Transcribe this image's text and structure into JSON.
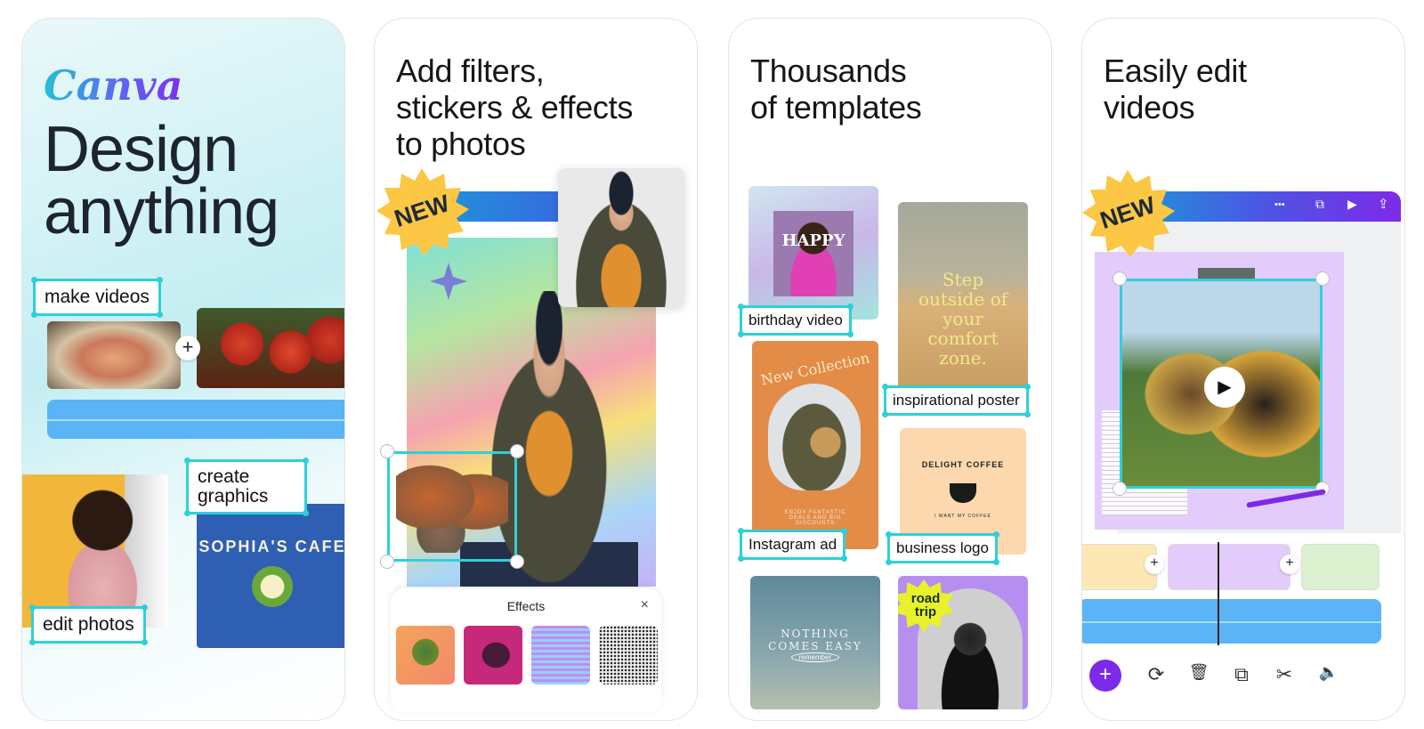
{
  "panels": [
    {
      "logo": "Canva",
      "headline_line1": "Design",
      "headline_line2": "anything",
      "tags": [
        "make videos",
        "create graphics",
        "edit photos"
      ],
      "graphic_text": "SOPHIA'S CAFE",
      "timeline_add": "+"
    },
    {
      "headline_line1": "Add filters,",
      "headline_line2": "stickers & effects",
      "headline_line3": "to photos",
      "badge": "NEW",
      "toolbar_more": "•••",
      "effects_panel": {
        "title": "Effects",
        "close_icon": "×",
        "thumbnails": [
          "effect-duotone-green",
          "effect-duotone-magenta",
          "effect-glitch",
          "effect-halftone"
        ]
      }
    },
    {
      "headline_line1": "Thousands",
      "headline_line2": "of templates",
      "templates": [
        {
          "label": "birthday video",
          "content": "HAPPY BIRTHDAY"
        },
        {
          "label": "inspirational poster",
          "content": "Step outside of your comfort zone."
        },
        {
          "label": "Instagram ad",
          "content": "New Collection",
          "subtext": "ENJOY FANTASTIC DEALS AND BIG DISCOUNTS"
        },
        {
          "label": "business logo",
          "content": "DELIGHT COFFEE",
          "subtext": "I WANT MY COFFEE"
        },
        {
          "label": "",
          "content": "NOTHING COMES EASY",
          "subtext": "remember"
        },
        {
          "label": "",
          "content": "road trip"
        }
      ]
    },
    {
      "headline_line1": "Easily edit",
      "headline_line2": "videos",
      "badge": "NEW",
      "toolbar": {
        "more": "•••",
        "pages": "⧉",
        "play": "▶",
        "share": "⇪"
      },
      "play_button": "▶",
      "timeline_add": "+",
      "bottom_tools": {
        "add": "+",
        "replace": "⟳",
        "delete": "🗑",
        "duplicate": "⧉",
        "split": "✂",
        "volume": "🔈"
      }
    }
  ],
  "colors": {
    "selection": "#2fd0d9",
    "badge": "#fbc745",
    "audio": "#5ab4f5",
    "accent_purple": "#7d2ae8",
    "canvas_lilac": "#e3ccfb"
  }
}
